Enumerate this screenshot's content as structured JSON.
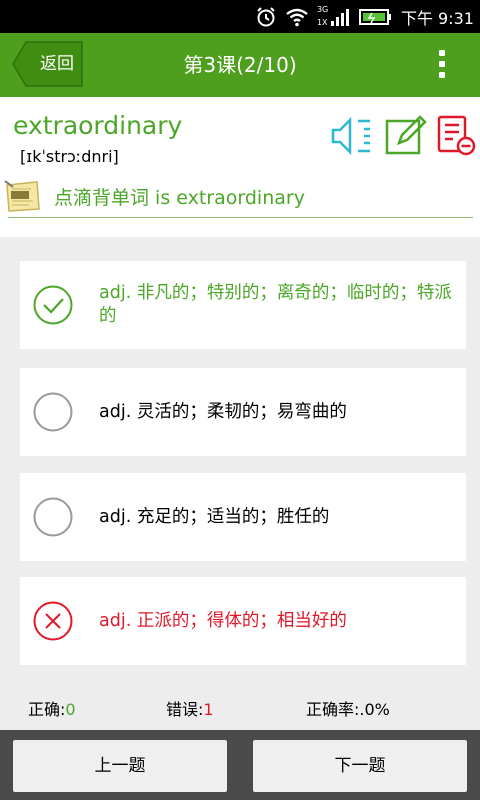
{
  "status_bar": {
    "network": "3G",
    "network2": "1X",
    "time": "下午 9:31"
  },
  "header": {
    "back_label": "返回",
    "title": "第3课(2/10)"
  },
  "word": {
    "text": "extraordinary",
    "phonetic": "[ɪkˈstrɔːdnri]"
  },
  "note": {
    "text": "点滴背单词 is extraordinary"
  },
  "options": [
    {
      "text": "adj. 非凡的；特别的；离奇的；临时的；特派的",
      "state": "correct"
    },
    {
      "text": "adj. 灵活的；柔韧的；易弯曲的",
      "state": "none"
    },
    {
      "text": "adj. 充足的；适当的；胜任的",
      "state": "none"
    },
    {
      "text": "adj. 正派的；得体的；相当好的",
      "state": "wrong"
    }
  ],
  "stats": {
    "correct_label": "正确:",
    "correct_value": "0",
    "wrong_label": "错误:",
    "wrong_value": "1",
    "rate_label": "正确率:",
    "rate_value": ".0%"
  },
  "buttons": {
    "prev": "上一题",
    "next": "下一题"
  },
  "colors": {
    "brand_green": "#4e9f1e",
    "text_green": "#4ca628",
    "accent_cyan": "#2bb7d6",
    "wrong_red": "#e0192a"
  }
}
